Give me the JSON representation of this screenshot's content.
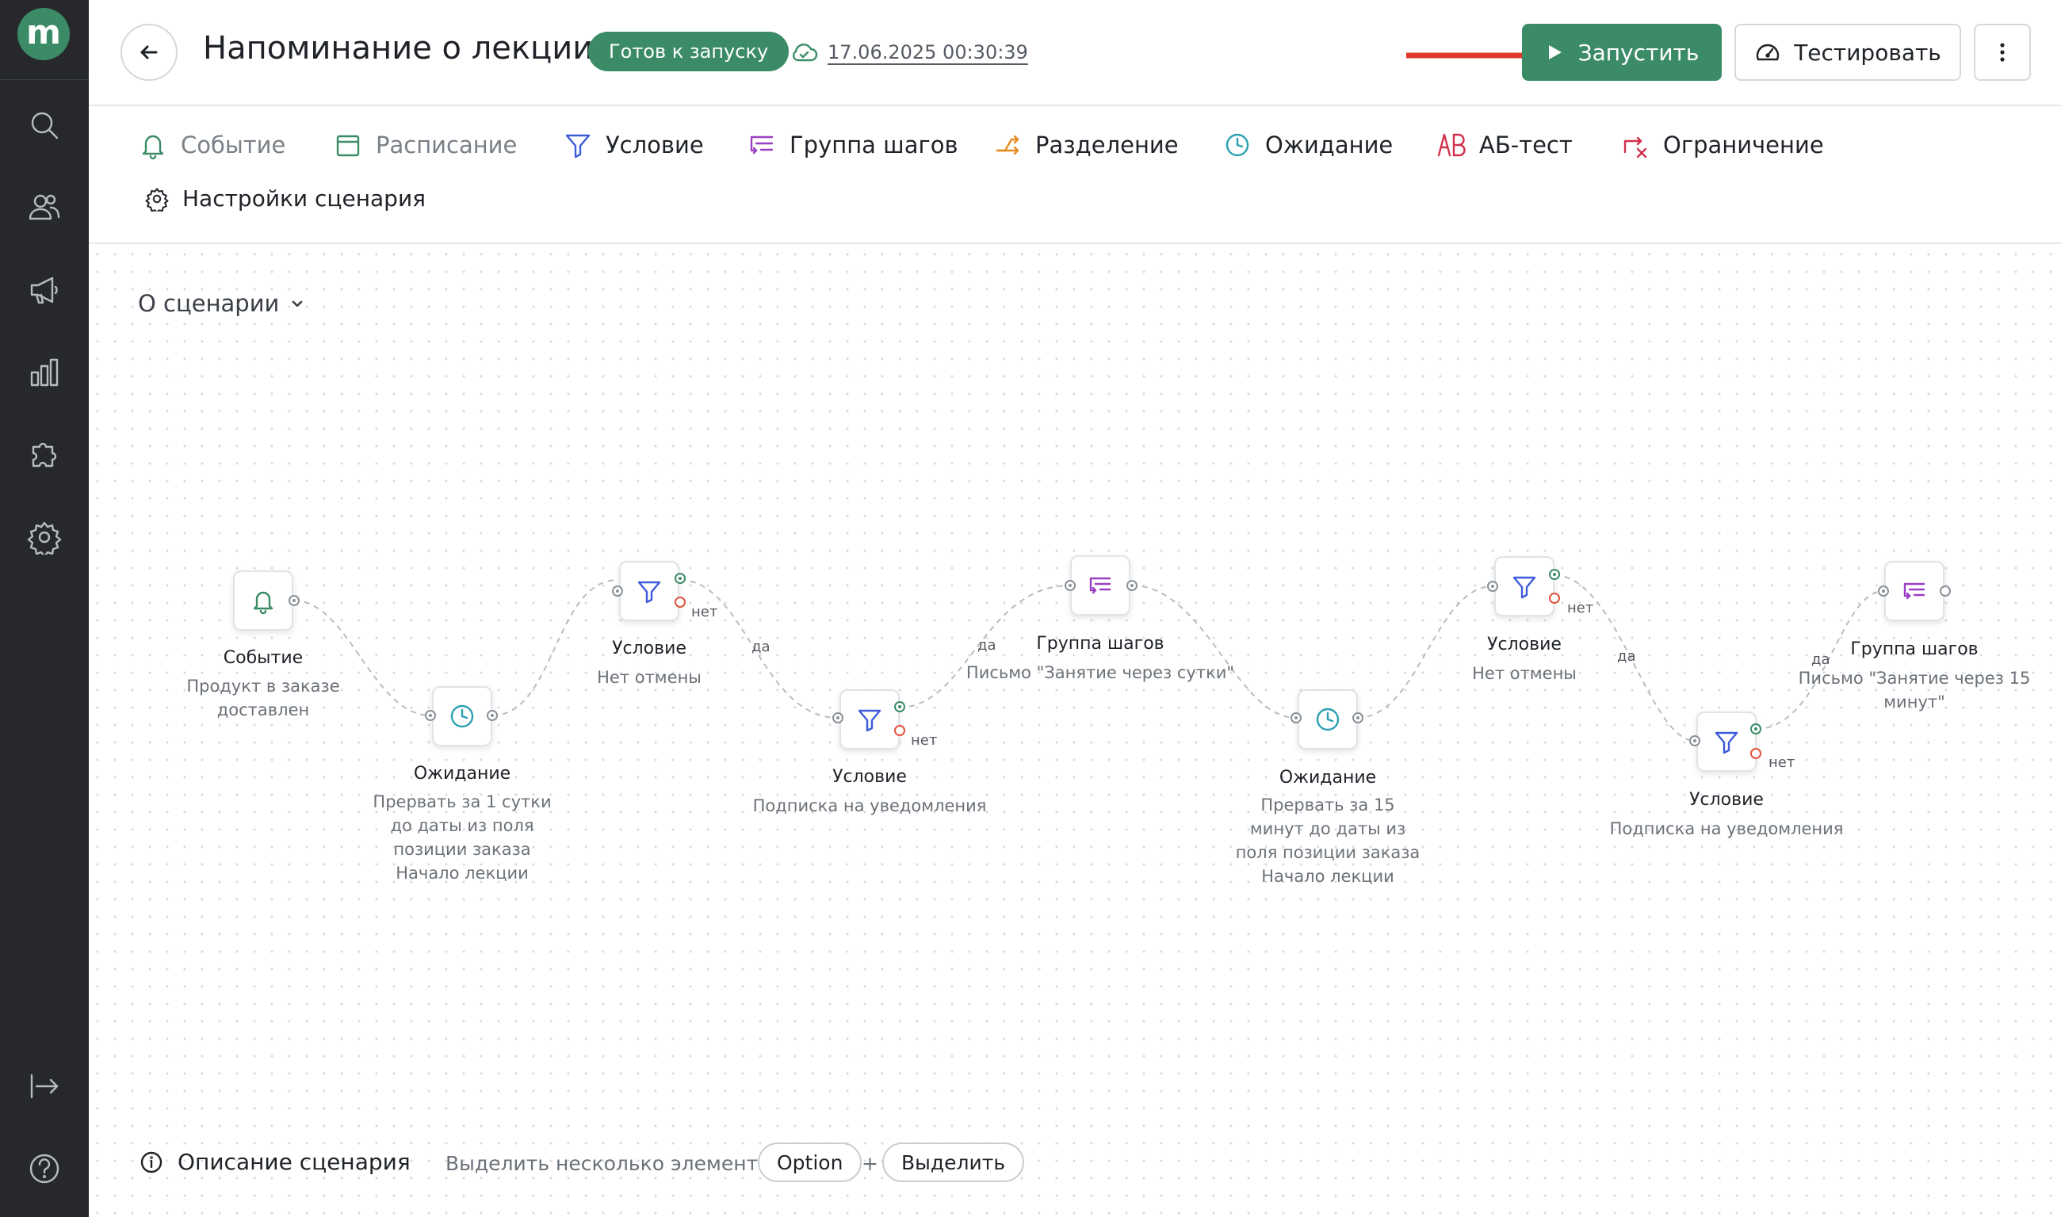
{
  "app": {
    "logo_letter": "m"
  },
  "header": {
    "title": "Напоминание о лекции",
    "status": "Готов к запуску",
    "saved_at": "17.06.2025 00:30:39",
    "run_label": "Запустить",
    "test_label": "Тестировать"
  },
  "toolbar": {
    "items": [
      {
        "label": "Событие",
        "icon": "bell-icon"
      },
      {
        "label": "Расписание",
        "icon": "calendar-icon"
      },
      {
        "label": "Условие",
        "icon": "filter-icon"
      },
      {
        "label": "Группа шагов",
        "icon": "step-group-icon"
      },
      {
        "label": "Разделение",
        "icon": "split-icon"
      },
      {
        "label": "Ожидание",
        "icon": "clock-icon"
      },
      {
        "label": "АБ-тест",
        "icon": "ab-test-icon"
      },
      {
        "label": "Ограничение",
        "icon": "limit-icon"
      }
    ],
    "settings_label": "Настройки сценария"
  },
  "canvas": {
    "about_label": "О сценарии"
  },
  "nodes": [
    {
      "title": "Событие",
      "desc": "Продукт в заказе доставлен"
    },
    {
      "title": "Ожидание",
      "desc": [
        "Прервать за 1 сутки",
        "до даты из поля",
        "позиции заказа",
        "Начало лекции"
      ]
    },
    {
      "title": "Условие",
      "desc": "Нет отмены"
    },
    {
      "title": "Условие",
      "desc": "Подписка на уведомления"
    },
    {
      "title": "Группа шагов",
      "desc": "Письмо \"Занятие через сутки\""
    },
    {
      "title": "Ожидание",
      "desc": [
        "Прервать за 15",
        "минут до даты из",
        "поля позиции заказа",
        "Начало лекции"
      ]
    },
    {
      "title": "Условие",
      "desc": "Нет отмены"
    },
    {
      "title": "Условие",
      "desc": "Подписка на уведомления"
    },
    {
      "title": "Группа шагов",
      "desc": [
        "Письмо \"Занятие через 15",
        "минут\""
      ]
    }
  ],
  "edge_labels": {
    "yes": "да",
    "no": "нет"
  },
  "footer": {
    "description_label": "Описание сценария",
    "hint": "Выделить несколько элементов",
    "key_option": "Option",
    "plus": "+",
    "key_select": "Выделить"
  },
  "colors": {
    "accent": "#3b8b67",
    "sidebar": "#26282c",
    "arrow": "#e0392b"
  }
}
